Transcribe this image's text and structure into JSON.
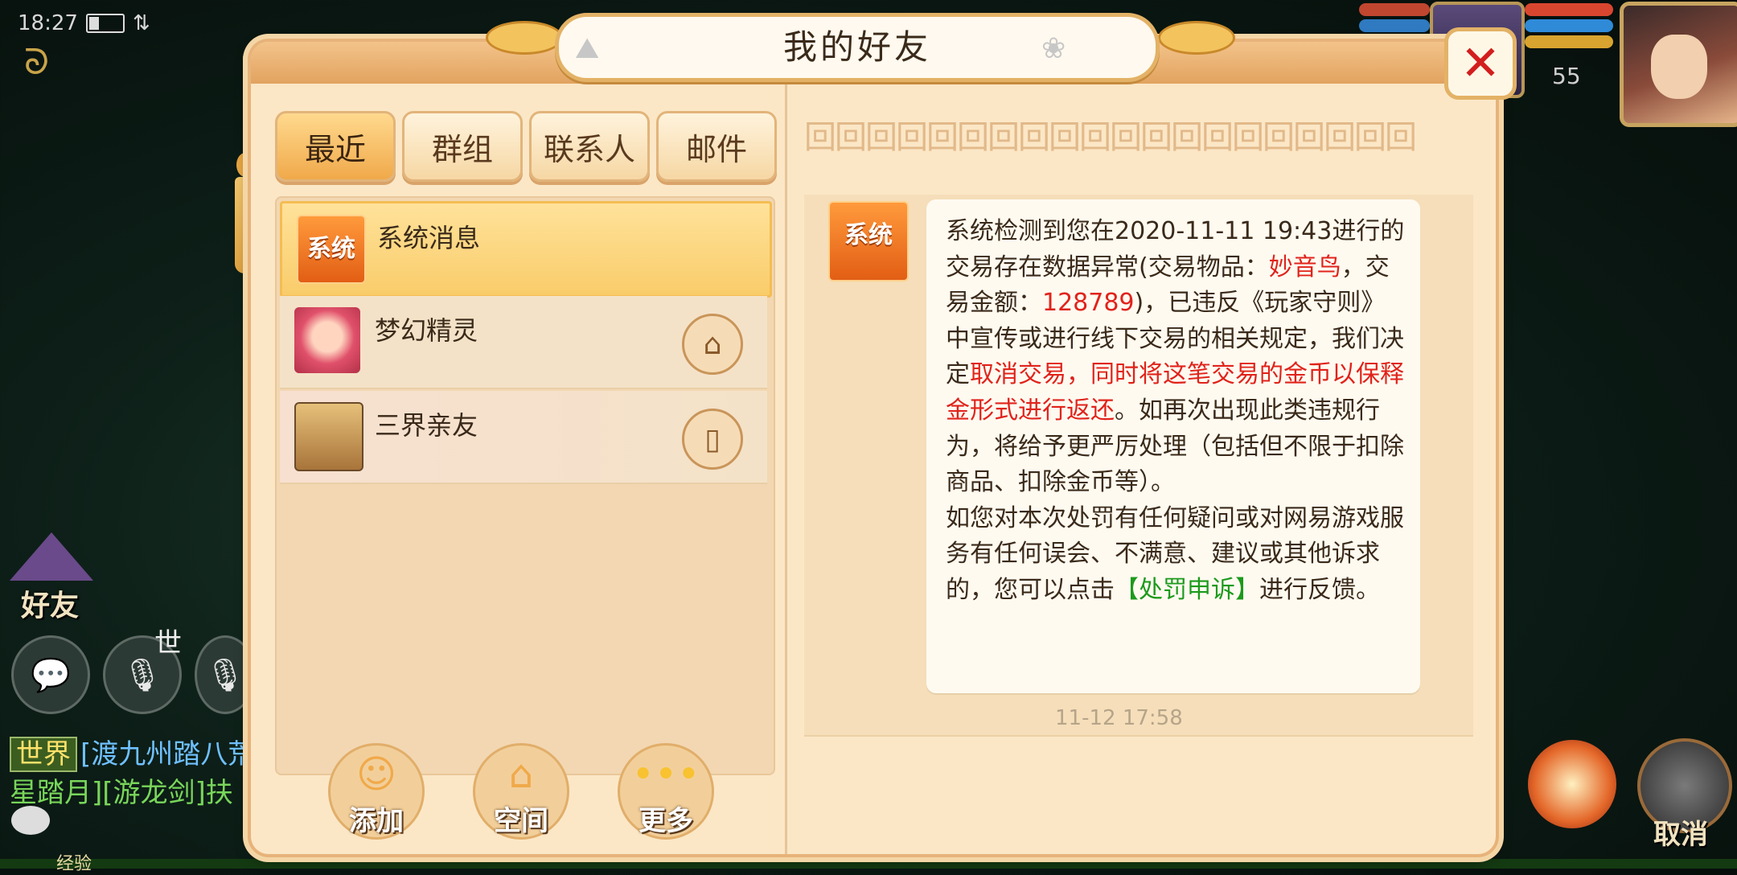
{
  "status_bar": {
    "time": "18:27"
  },
  "hud": {
    "level": "55"
  },
  "side": {
    "friend_label": "好友",
    "voice_world_label": "世",
    "cancel_label": "取消",
    "exp_label": "经验"
  },
  "chat": {
    "world_tag": "世界",
    "line1_text": "[渡九州踏八荒",
    "line2_text": "星踏月][游龙剑]扶",
    "link_blue_color": "#6fc0ff"
  },
  "dialog": {
    "title": "我的好友",
    "close_icon": "close-x-icon",
    "tabs": [
      {
        "label": "最近",
        "active": true
      },
      {
        "label": "群组",
        "active": false
      },
      {
        "label": "联系人",
        "active": false
      },
      {
        "label": "邮件",
        "active": false
      }
    ],
    "contacts": [
      {
        "name": "系统消息",
        "avatar_label": "系统",
        "active": true
      },
      {
        "name": "梦幻精灵",
        "icon": "home-icon",
        "active": false
      },
      {
        "name": "三界亲友",
        "icon": "book-icon",
        "active": false
      }
    ],
    "bottom_buttons": [
      {
        "label": "添加",
        "icon": "add-friend-icon"
      },
      {
        "label": "空间",
        "icon": "house-icon"
      },
      {
        "label": "更多",
        "icon": "more-dots-icon"
      }
    ],
    "message": {
      "sender_badge": "系统",
      "p1_a": "系统检测到您在2020-11-11 19:43进行的交易存在数据异常(交易物品：",
      "p1_item": "妙音鸟",
      "p1_b": "，交易金额：",
      "p1_amount": "128789",
      "p1_c": ")，已违反《玩家守则》中宣传或进行线下交易的相关规定，我们决定",
      "p1_red": "取消交易，同时将这笔交易的金币以保释金形式进行返还",
      "p1_d": "。如再次出现此类违规行为，将给予更严厉处理（包括但不限于扣除商品、扣除金币等）。",
      "p2_a": "如您对本次处罚有任何疑问或对网易游戏服务有任何误会、不满意、建议或其他诉求的，您可以点击",
      "p2_link": "【处罚申诉】",
      "p2_b": "进行反馈。",
      "timestamp": "11-12 17:58"
    }
  },
  "colors": {
    "accent_orange": "#f0a94a",
    "alert_red": "#e0231b",
    "link_green": "#1c9a1c",
    "panel_bg": "#fbe7c6"
  }
}
